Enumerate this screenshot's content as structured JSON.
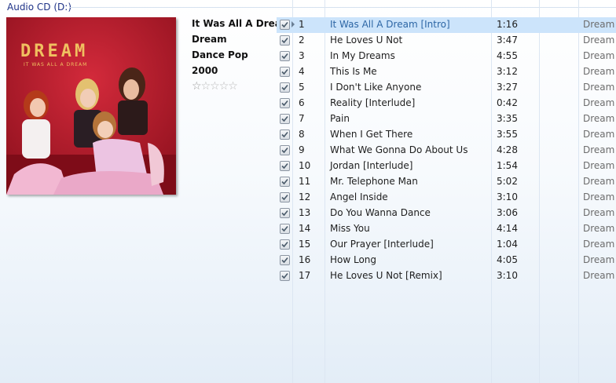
{
  "group": {
    "title": "Audio CD (D:)"
  },
  "album": {
    "cover_logo": "DREAM",
    "cover_subtitle": "IT WAS ALL A DREAM",
    "title": "It Was All A Dream",
    "artist": "Dream",
    "genre": "Dance Pop",
    "year": "2000",
    "rating_stars": 5,
    "rating_value": 0.5
  },
  "colors": {
    "selected_row": "#cce4fb",
    "selected_text": "#2d66a5",
    "cover_bg": "#b51a2a",
    "logo": "#f0c060"
  },
  "tracks": [
    {
      "checked": true,
      "num": "1",
      "title": "It Was All A Dream [Intro]",
      "length": "1:16",
      "artist": "Dream",
      "selected": true
    },
    {
      "checked": true,
      "num": "2",
      "title": "He Loves U Not",
      "length": "3:47",
      "artist": "Dream"
    },
    {
      "checked": true,
      "num": "3",
      "title": "In My Dreams",
      "length": "4:55",
      "artist": "Dream"
    },
    {
      "checked": true,
      "num": "4",
      "title": "This Is Me",
      "length": "3:12",
      "artist": "Dream"
    },
    {
      "checked": true,
      "num": "5",
      "title": "I Don't Like Anyone",
      "length": "3:27",
      "artist": "Dream"
    },
    {
      "checked": true,
      "num": "6",
      "title": "Reality [Interlude]",
      "length": "0:42",
      "artist": "Dream"
    },
    {
      "checked": true,
      "num": "7",
      "title": "Pain",
      "length": "3:35",
      "artist": "Dream"
    },
    {
      "checked": true,
      "num": "8",
      "title": "When I Get There",
      "length": "3:55",
      "artist": "Dream"
    },
    {
      "checked": true,
      "num": "9",
      "title": "What We Gonna Do About Us",
      "length": "4:28",
      "artist": "Dream"
    },
    {
      "checked": true,
      "num": "10",
      "title": "Jordan [Interlude]",
      "length": "1:54",
      "artist": "Dream"
    },
    {
      "checked": true,
      "num": "11",
      "title": "Mr. Telephone Man",
      "length": "5:02",
      "artist": "Dream"
    },
    {
      "checked": true,
      "num": "12",
      "title": "Angel Inside",
      "length": "3:10",
      "artist": "Dream"
    },
    {
      "checked": true,
      "num": "13",
      "title": "Do You Wanna Dance",
      "length": "3:06",
      "artist": "Dream"
    },
    {
      "checked": true,
      "num": "14",
      "title": "Miss You",
      "length": "4:14",
      "artist": "Dream"
    },
    {
      "checked": true,
      "num": "15",
      "title": "Our Prayer [Interlude]",
      "length": "1:04",
      "artist": "Dream"
    },
    {
      "checked": true,
      "num": "16",
      "title": "How Long",
      "length": "4:05",
      "artist": "Dream"
    },
    {
      "checked": true,
      "num": "17",
      "title": "He Loves U Not [Remix]",
      "length": "3:10",
      "artist": "Dream"
    }
  ]
}
